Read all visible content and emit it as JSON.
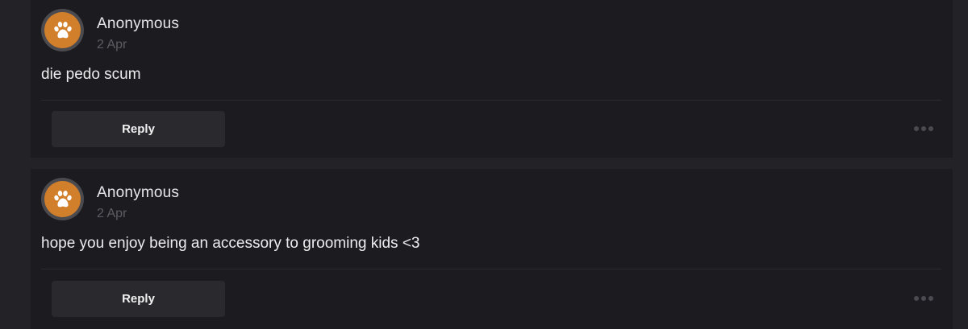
{
  "comments": [
    {
      "author": "Anonymous",
      "date": "2 Apr",
      "text": "die pedo scum",
      "reply_label": "Reply",
      "avatar_icon": "paw-icon",
      "avatar_color": "#d27f2c"
    },
    {
      "author": "Anonymous",
      "date": "2 Apr",
      "text": "hope you enjoy being an accessory to grooming kids <3",
      "reply_label": "Reply",
      "avatar_icon": "paw-icon",
      "avatar_color": "#d27f2c"
    }
  ],
  "more_icon": "more-options-icon"
}
